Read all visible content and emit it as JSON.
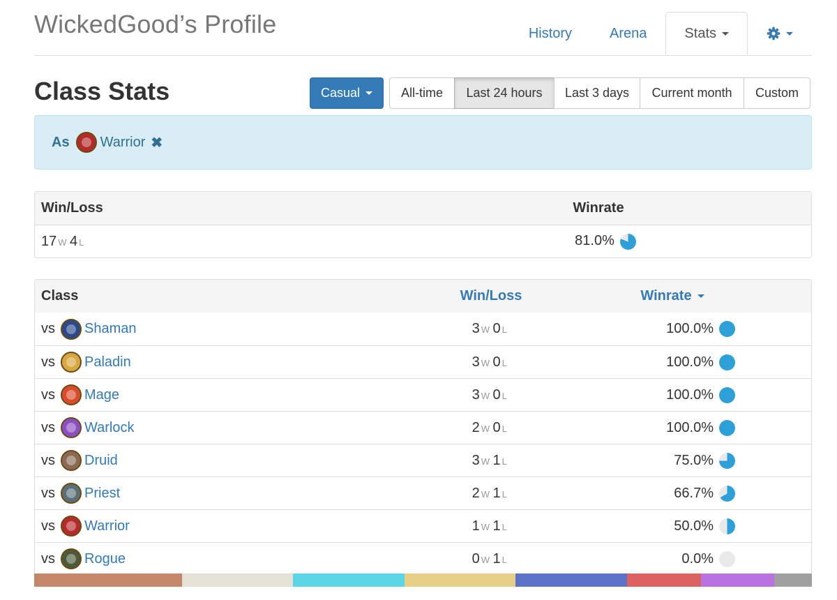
{
  "profile": {
    "title": "WickedGood’s Profile"
  },
  "nav": {
    "tabs": [
      {
        "label": "History"
      },
      {
        "label": "Arena"
      },
      {
        "label": "Stats"
      }
    ],
    "settings_icon": "gear-icon"
  },
  "section": {
    "title": "Class Stats"
  },
  "mode": {
    "selected": "Casual"
  },
  "ranges": [
    {
      "label": "All-time"
    },
    {
      "label": "Last 24 hours"
    },
    {
      "label": "Last 3 days"
    },
    {
      "label": "Current month"
    },
    {
      "label": "Custom"
    }
  ],
  "active_range": "Last 24 hours",
  "filter": {
    "prefix": "As",
    "class": "Warrior",
    "icon": "warrior-class-icon",
    "remove_icon": "close-icon"
  },
  "summary": {
    "headers": {
      "winloss": "Win/Loss",
      "winrate": "Winrate"
    },
    "wins": "17",
    "losses": "4",
    "w_unit": "W",
    "l_unit": "L",
    "winrate": "81.0%",
    "winrate_value": 0.81
  },
  "table": {
    "headers": {
      "class": "Class",
      "winloss": "Win/Loss",
      "winrate": "Winrate"
    },
    "vs": "vs",
    "rows": [
      {
        "class": "Shaman",
        "wins": "3",
        "losses": "0",
        "winrate": "100.0%",
        "winrate_value": 1.0,
        "icon_color": "#2a4a8a"
      },
      {
        "class": "Paladin",
        "wins": "3",
        "losses": "0",
        "winrate": "100.0%",
        "winrate_value": 1.0,
        "icon_color": "#d9a741"
      },
      {
        "class": "Mage",
        "wins": "3",
        "losses": "0",
        "winrate": "100.0%",
        "winrate_value": 1.0,
        "icon_color": "#d94b2b"
      },
      {
        "class": "Warlock",
        "wins": "2",
        "losses": "0",
        "winrate": "100.0%",
        "winrate_value": 1.0,
        "icon_color": "#8a4fc0"
      },
      {
        "class": "Druid",
        "wins": "3",
        "losses": "1",
        "winrate": "75.0%",
        "winrate_value": 0.75,
        "icon_color": "#8a6a55"
      },
      {
        "class": "Priest",
        "wins": "2",
        "losses": "1",
        "winrate": "66.7%",
        "winrate_value": 0.667,
        "icon_color": "#5b6f78"
      },
      {
        "class": "Warrior",
        "wins": "1",
        "losses": "1",
        "winrate": "50.0%",
        "winrate_value": 0.5,
        "icon_color": "#b52a2a"
      },
      {
        "class": "Rogue",
        "wins": "0",
        "losses": "1",
        "winrate": "0.0%",
        "winrate_value": 0.0,
        "icon_color": "#4d5a3a"
      }
    ]
  },
  "colorbar": [
    {
      "color": "#c4876a",
      "share": 0.19
    },
    {
      "color": "#e6e1d6",
      "share": 0.143
    },
    {
      "color": "#5bd6e6",
      "share": 0.143
    },
    {
      "color": "#e8cf86",
      "share": 0.143
    },
    {
      "color": "#5b72c8",
      "share": 0.143
    },
    {
      "color": "#dc6262",
      "share": 0.095
    },
    {
      "color": "#b873e0",
      "share": 0.095
    },
    {
      "color": "#a0a0a0",
      "share": 0.048
    }
  ],
  "colors": {
    "link": "#337ab7",
    "pie": "#2d9fd9",
    "pie_bg": "#e9e9e9"
  }
}
